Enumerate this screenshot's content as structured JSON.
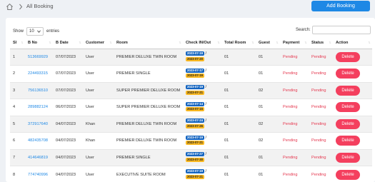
{
  "breadcrumb": {
    "current": "All Booking"
  },
  "header": {
    "add_button": "Add Booking"
  },
  "controls": {
    "show_label": "Show",
    "page_size": "10",
    "entries_label": "entries",
    "search_label": "Search:",
    "search_value": ""
  },
  "table": {
    "headers": [
      "Sl",
      "B No",
      "B Date",
      "Customer",
      "Room",
      "Check IN/Out",
      "Total Room",
      "Guest",
      "Payment",
      "Status",
      "Action"
    ],
    "rows": [
      {
        "sl": "1",
        "bno": "513669929",
        "bdate": "07/07/2023",
        "customer": "User",
        "room": "PREMIER DELUXE TWIN ROOM",
        "check_in": "2023-07-19",
        "check_out": "2023-07-20",
        "total_room": "01",
        "guest": "01",
        "payment": "Pending",
        "status": "Pending",
        "action": "Delete"
      },
      {
        "sl": "2",
        "bno": "224493315",
        "bdate": "07/07/2023",
        "customer": "User",
        "room": "PREMIER SINGLE",
        "check_in": "2023-07-17",
        "check_out": "2023-07-19",
        "total_room": "01",
        "guest": "01",
        "payment": "Pending",
        "status": "Pending",
        "action": "Delete"
      },
      {
        "sl": "3",
        "bno": "756136510",
        "bdate": "07/07/2023",
        "customer": "User",
        "room": "SUPER PREMIER DELUXE ROOM",
        "check_in": "2023-07-19",
        "check_out": "2023-07-21",
        "total_room": "01",
        "guest": "02",
        "payment": "Pending",
        "status": "Pending",
        "action": "Delete"
      },
      {
        "sl": "4",
        "bno": "289882124",
        "bdate": "06/07/2023",
        "customer": "User",
        "room": "SUPER PREMIER DELUXE ROOM",
        "check_in": "2023-07-14",
        "check_out": "2023-07-15",
        "total_room": "01",
        "guest": "01",
        "payment": "Pending",
        "status": "Pending",
        "action": "Delete"
      },
      {
        "sl": "5",
        "bno": "372917640",
        "bdate": "04/07/2023",
        "customer": "Khan",
        "room": "PREMIER DELUXE TWIN ROOM",
        "check_in": "2023-07-24",
        "check_out": "2023-07-26",
        "total_room": "01",
        "guest": "02",
        "payment": "Pending",
        "status": "Pending",
        "action": "Delete"
      },
      {
        "sl": "6",
        "bno": "482435708",
        "bdate": "04/07/2023",
        "customer": "Khan",
        "room": "PREMIER DELUXE TWIN ROOM",
        "check_in": "2023-07-19",
        "check_out": "2023-07-21",
        "total_room": "01",
        "guest": "02",
        "payment": "Pending",
        "status": "Pending",
        "action": "Delete"
      },
      {
        "sl": "7",
        "bno": "414646819",
        "bdate": "04/07/2023",
        "customer": "User",
        "room": "PREMIER SINGLE",
        "check_in": "2023-07-27",
        "check_out": "2023-07-30",
        "total_room": "01",
        "guest": "01",
        "payment": "Pending",
        "status": "Pending",
        "action": "Delete"
      },
      {
        "sl": "8",
        "bno": "774740996",
        "bdate": "04/07/2023",
        "customer": "User",
        "room": "EXECUTIVE SUITE ROOM",
        "check_in": "2023-07-19",
        "check_out": "2023-07-21",
        "total_room": "01",
        "guest": "01",
        "payment": "Pending",
        "status": "Pending",
        "action": "Delete"
      }
    ]
  }
}
